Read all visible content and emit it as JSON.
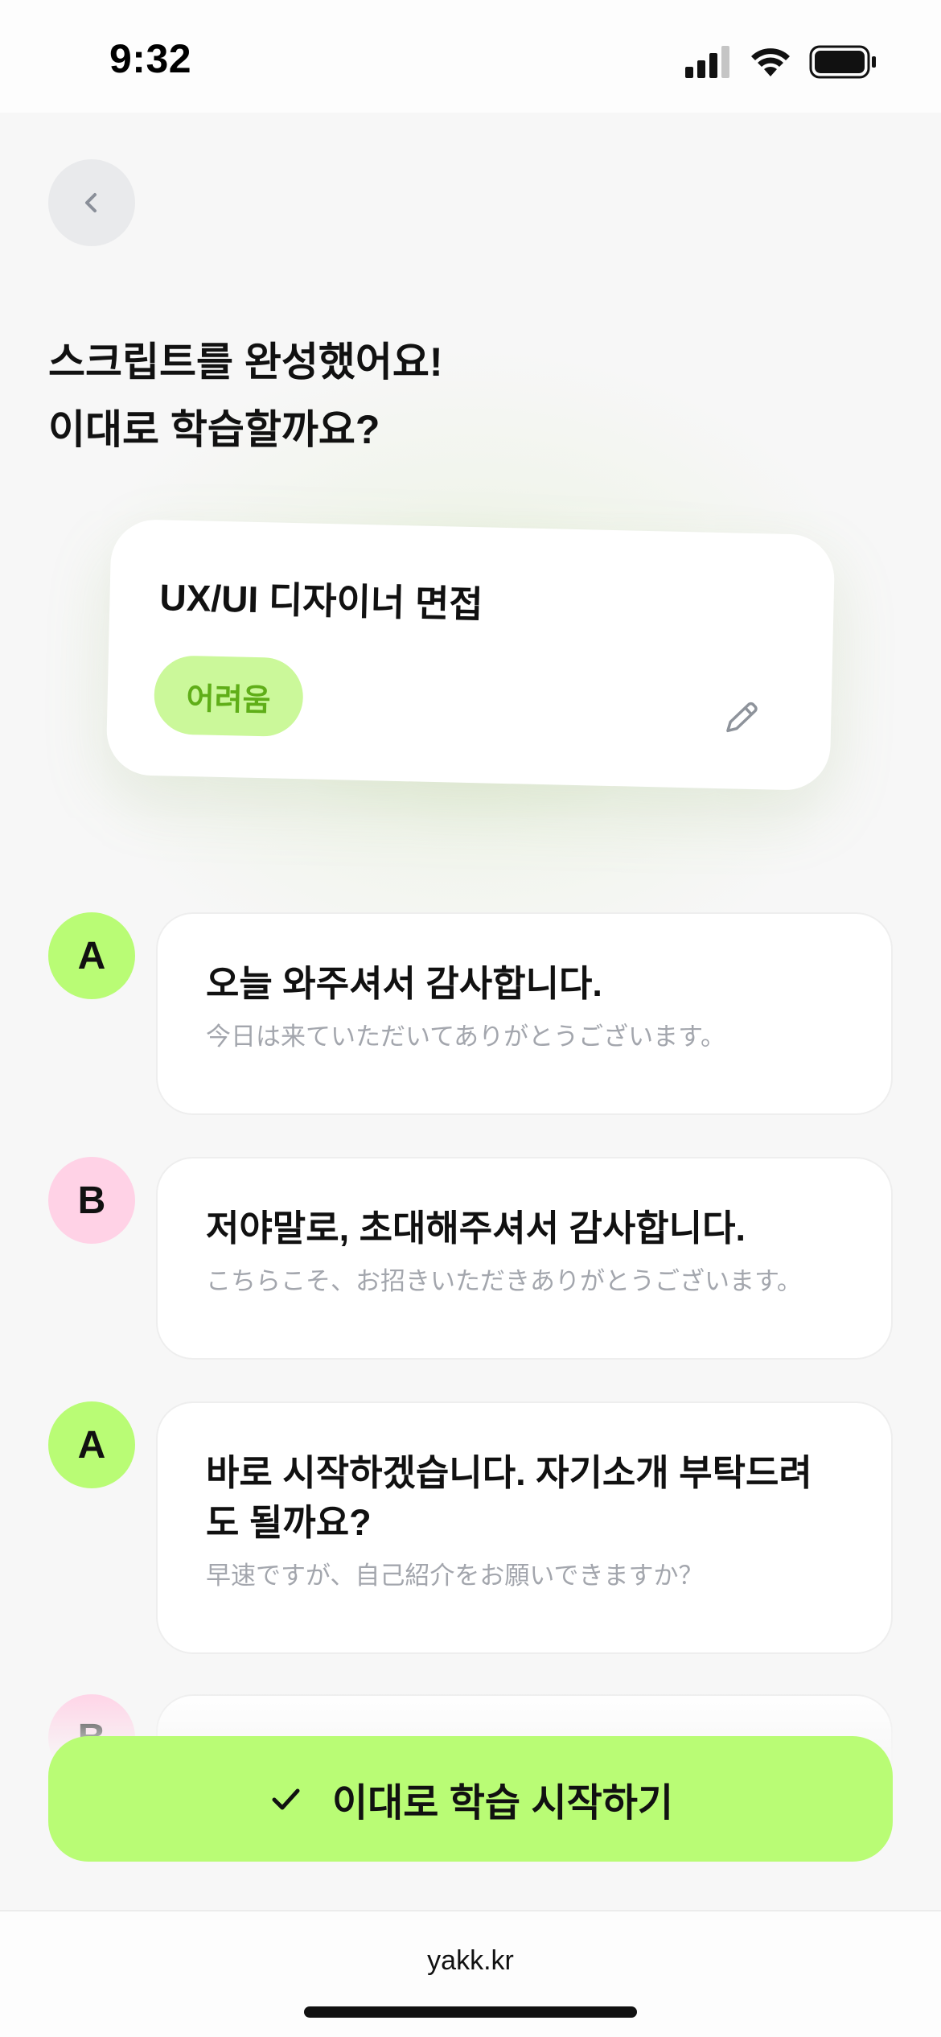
{
  "status_bar": {
    "time": "9:32",
    "battery_level": 1.0,
    "signal_bars": "3 of 4"
  },
  "header": {
    "back_icon": "chevron-left-icon",
    "title_line1": "스크립트를 완성했어요!",
    "title_line2": "이대로 학습할까요?"
  },
  "topic_card": {
    "title": "UX/UI 디자이너 면접",
    "difficulty": "어려움",
    "edit_icon": "pencil-icon"
  },
  "messages": [
    {
      "speaker": "A",
      "text": "오늘 와주셔서 감사합니다.",
      "translation": "今日は来ていただいてありがとうございます。"
    },
    {
      "speaker": "B",
      "text": "저야말로, 초대해주셔서 감사합니다.",
      "translation": "こちらこそ、お招きいただきありがとうございます。"
    },
    {
      "speaker": "A",
      "text": "바로 시작하겠습니다. 자기소개 부탁드려도 될까요?",
      "translation": "早速ですが、自己紹介をお願いできますか？"
    },
    {
      "speaker": "B",
      "text": "",
      "translation": ""
    }
  ],
  "cta": {
    "label": "이대로 학습 시작하기",
    "icon": "check-icon"
  },
  "browser": {
    "url": "yakk.kr"
  },
  "colors": {
    "accent": "#b9fc75",
    "speaker_b": "#ffd2e6",
    "badge_text": "#5fae18",
    "subtext": "#a3a6ad"
  }
}
